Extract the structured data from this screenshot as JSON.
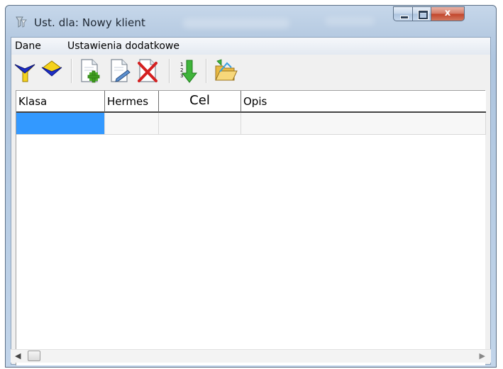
{
  "window": {
    "title": "Ust. dla: Nowy klient",
    "close_glyph": "x"
  },
  "menu": {
    "items": [
      {
        "label": "Dane"
      },
      {
        "label": "Ustawienia dodatkowe"
      }
    ]
  },
  "toolbar": {
    "buttons": [
      {
        "icon": "filter-funnel-icon"
      },
      {
        "icon": "filter-clear-icon"
      },
      {
        "icon": "add-document-icon"
      },
      {
        "icon": "edit-document-icon"
      },
      {
        "icon": "delete-icon"
      },
      {
        "icon": "sort-down-icon"
      },
      {
        "icon": "open-folder-icon"
      }
    ]
  },
  "grid": {
    "columns": [
      {
        "label": "Klasa"
      },
      {
        "label": "Hermes"
      },
      {
        "label": "Cel"
      },
      {
        "label": "Opis"
      }
    ],
    "rows": [
      {
        "klasa": "",
        "hermes": "",
        "cel": "",
        "opis": "",
        "selected_column": "klasa"
      }
    ]
  },
  "colors": {
    "selection": "#3399ff",
    "titlebar": "#b7cbe2"
  }
}
